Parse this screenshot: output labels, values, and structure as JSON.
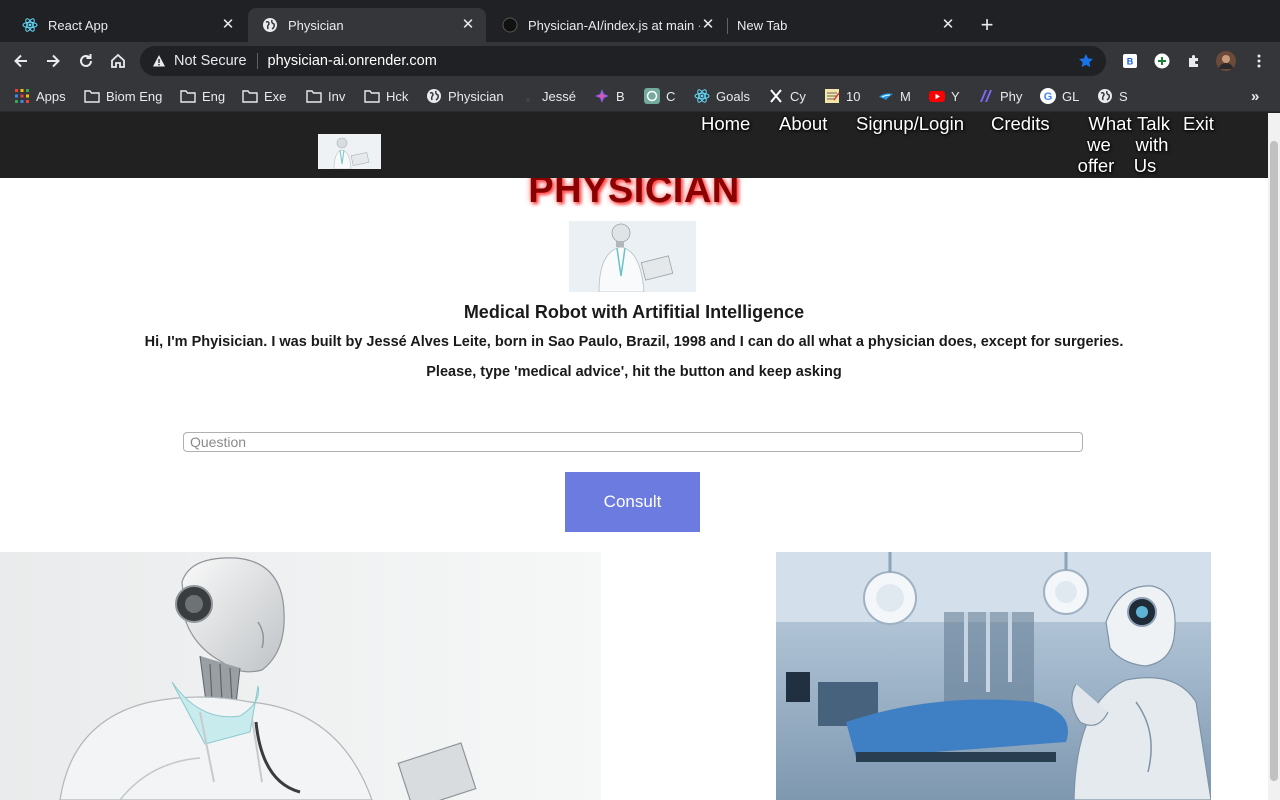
{
  "tabs": [
    {
      "title": "React App",
      "favicon": "react-icon"
    },
    {
      "title": "Physician",
      "favicon": "globe-icon"
    },
    {
      "title": "Physician-AI/index.js at main ·",
      "favicon": "github-icon"
    },
    {
      "title": "New Tab",
      "favicon": "none"
    }
  ],
  "address_bar": {
    "security": "Not Secure",
    "url": "physician-ai.onrender.com"
  },
  "bookmarks": [
    {
      "label": "Apps",
      "icon": "apps-grid-icon"
    },
    {
      "label": "Biom Eng",
      "icon": "folder-icon"
    },
    {
      "label": "Eng",
      "icon": "folder-icon"
    },
    {
      "label": "Exe",
      "icon": "folder-icon"
    },
    {
      "label": "Inv",
      "icon": "folder-icon"
    },
    {
      "label": "Hck",
      "icon": "folder-icon"
    },
    {
      "label": "Physician",
      "icon": "globe-icon"
    },
    {
      "label": "Jessé",
      "icon": "profile-icon"
    },
    {
      "label": "B",
      "icon": "sparkle-icon"
    },
    {
      "label": "C",
      "icon": "chatgpt-icon"
    },
    {
      "label": "Goals",
      "icon": "react-icon"
    },
    {
      "label": "Cy",
      "icon": "x-icon"
    },
    {
      "label": "10",
      "icon": "notepad-icon"
    },
    {
      "label": "M",
      "icon": "bird-icon"
    },
    {
      "label": "Y",
      "icon": "youtube-icon"
    },
    {
      "label": "Phy",
      "icon": "stripes-icon"
    },
    {
      "label": "GL",
      "icon": "google-icon"
    },
    {
      "label": "S",
      "icon": "globe-icon"
    }
  ],
  "site_nav": {
    "home": "Home",
    "about": "About",
    "signup": "Signup/Login",
    "credits": "Credits",
    "offer_l1": "What",
    "offer_l2": "we",
    "offer_l3": "offer",
    "talk_l1": "Talk",
    "talk_l2": "with",
    "talk_l3": "Us",
    "exit": "Exit"
  },
  "main": {
    "title": "PHYSICIAN",
    "subtitle": "Medical Robot with Artifitial Intelligence",
    "intro": "Hi, I'm Phyisician. I was built by Jessé Alves Leite, born in Sao Paulo, Brazil, 1998 and I can do all what a physician does, except for surgeries.",
    "instructions": "Please, type 'medical advice', hit the button and keep asking",
    "question_placeholder": "Question",
    "question_value": "",
    "consult_label": "Consult"
  },
  "colors": {
    "chrome_dark": "#202124",
    "chrome_toolbar": "#35363a",
    "site_nav": "#212121",
    "title": "#8b0000",
    "title_glow": "#ff6b6b",
    "button": "#6b7be0"
  }
}
